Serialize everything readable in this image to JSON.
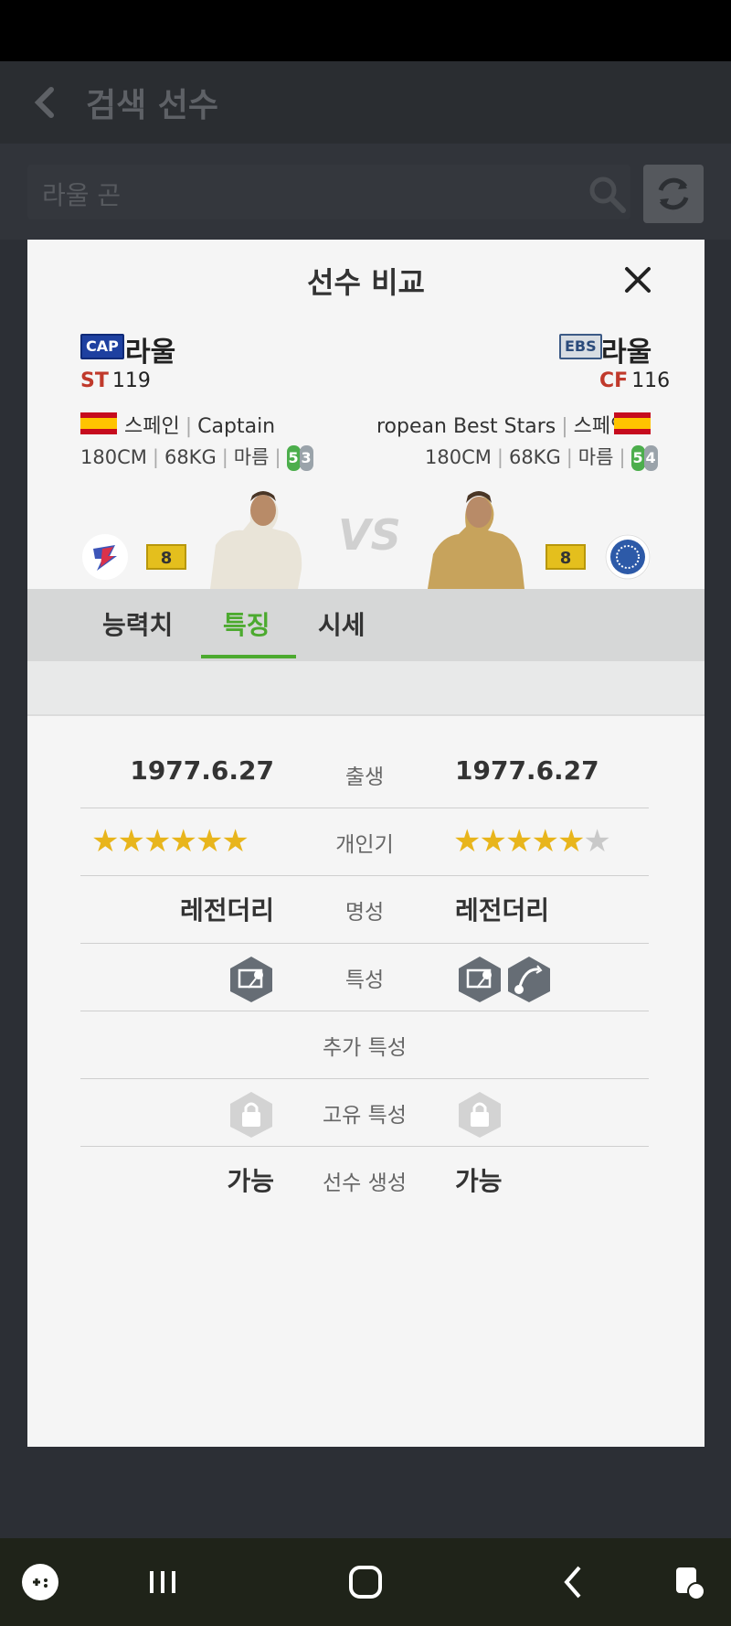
{
  "background": {
    "title": "검색 선수",
    "search_value": "라울 곤"
  },
  "modal": {
    "title": "선수 비교",
    "left": {
      "badge": "CAP",
      "name": "라울",
      "position": "ST",
      "ovr": "119",
      "info1": "스페인 | Captain",
      "info1_parts": [
        "스페인",
        "Captain"
      ],
      "height": "180CM",
      "weight": "68KG",
      "build": "마름",
      "foot_left": "5",
      "foot_right": "3",
      "level": "8"
    },
    "right": {
      "badge": "EBS",
      "name": "라울",
      "position": "CF",
      "ovr": "116",
      "info1_parts": [
        "ropean Best Stars",
        "스페인"
      ],
      "height": "180CM",
      "weight": "68KG",
      "build": "마름",
      "foot_left": "5",
      "foot_right": "4",
      "level": "8"
    },
    "vs": "VS",
    "tabs": [
      "능력치",
      "특징",
      "시세"
    ],
    "active_tab": "특징",
    "rows": {
      "birth": {
        "label": "출생",
        "left": "1977.6.27",
        "right": "1977.6.27"
      },
      "popularity": {
        "label": "개인기",
        "left_stars": 6,
        "right_stars": 5,
        "right_max": 6
      },
      "fame": {
        "label": "명성",
        "left": "레전더리",
        "right": "레전더리"
      },
      "traits": {
        "label": "특성"
      },
      "extra_traits": {
        "label": "추가 특성"
      },
      "unique_traits": {
        "label": "고유 특성"
      },
      "creation": {
        "label": "선수 생성",
        "left": "가능",
        "right": "가능"
      }
    }
  },
  "colors": {
    "accent": "#4caa2f",
    "star": "#e8b51c",
    "pos": "#c0392b"
  }
}
